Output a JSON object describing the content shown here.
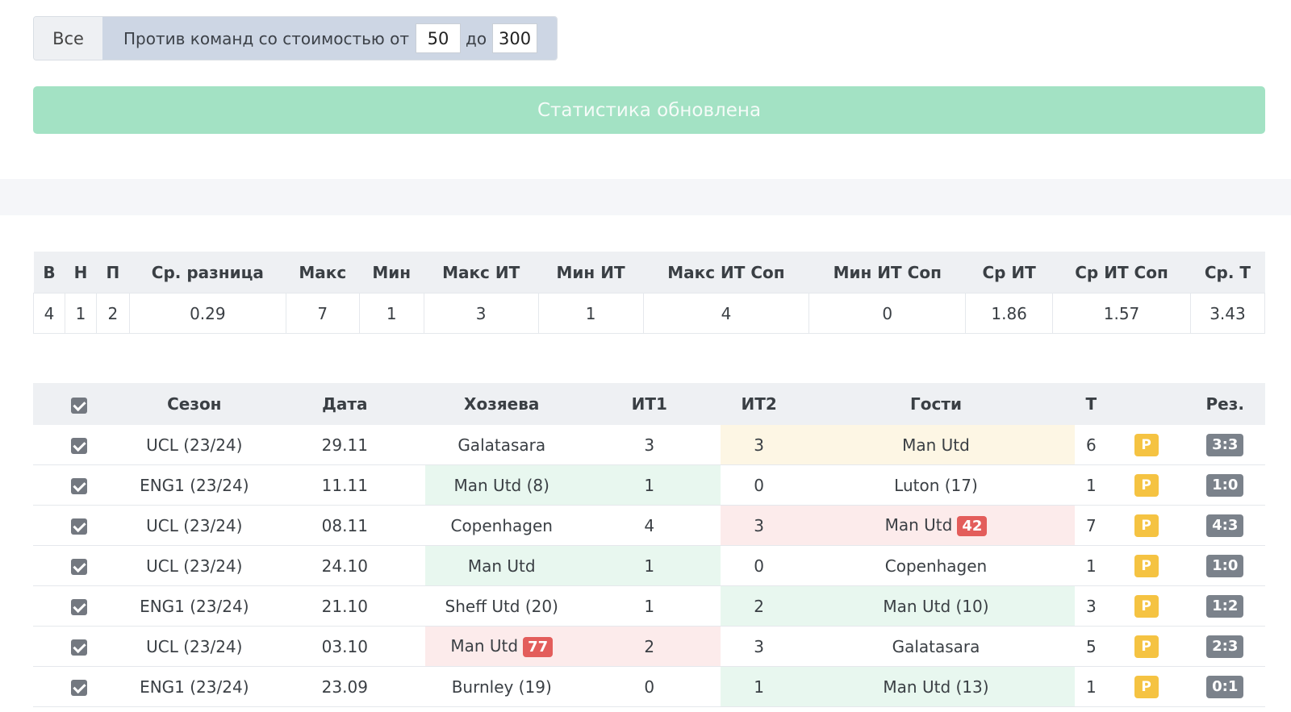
{
  "filter": {
    "all_label": "Все",
    "range_label": "Против команд со стоимостью от",
    "from_value": "50",
    "to_label": "до",
    "to_value": "300"
  },
  "alert": {
    "text": "Статистика обновлена"
  },
  "summary": {
    "headers": [
      "В",
      "Н",
      "П",
      "Ср. разница",
      "Макс",
      "Мин",
      "Макс ИТ",
      "Мин ИТ",
      "Макс ИТ Соп",
      "Мин ИТ Соп",
      "Ср ИТ",
      "Ср ИТ Соп",
      "Ср. Т"
    ],
    "values": [
      "4",
      "1",
      "2",
      "0.29",
      "7",
      "1",
      "3",
      "1",
      "4",
      "0",
      "1.86",
      "1.57",
      "3.43"
    ]
  },
  "matches": {
    "headers": {
      "season": "Сезон",
      "date": "Дата",
      "home": "Хозяева",
      "it1": "ИТ1",
      "it2": "ИТ2",
      "away": "Гости",
      "total": "Т",
      "result": "Рез."
    },
    "rows": [
      {
        "season": "UCL (23/24)",
        "date": "29.11",
        "home": "Galatasara",
        "home_badge": "",
        "it1": "3",
        "it2": "3",
        "away": "Man Utd",
        "away_badge": "",
        "total": "6",
        "p": "P",
        "score": "3:3",
        "hl_home": "",
        "hl_away": "yellow"
      },
      {
        "season": "ENG1 (23/24)",
        "date": "11.11",
        "home": "Man Utd (8)",
        "home_badge": "",
        "it1": "1",
        "it2": "0",
        "away": "Luton (17)",
        "away_badge": "",
        "total": "1",
        "p": "P",
        "score": "1:0",
        "hl_home": "green",
        "hl_away": ""
      },
      {
        "season": "UCL (23/24)",
        "date": "08.11",
        "home": "Copenhagen",
        "home_badge": "",
        "it1": "4",
        "it2": "3",
        "away": "Man Utd",
        "away_badge": "42",
        "total": "7",
        "p": "P",
        "score": "4:3",
        "hl_home": "",
        "hl_away": "red"
      },
      {
        "season": "UCL (23/24)",
        "date": "24.10",
        "home": "Man Utd",
        "home_badge": "",
        "it1": "1",
        "it2": "0",
        "away": "Copenhagen",
        "away_badge": "",
        "total": "1",
        "p": "P",
        "score": "1:0",
        "hl_home": "green",
        "hl_away": ""
      },
      {
        "season": "ENG1 (23/24)",
        "date": "21.10",
        "home": "Sheff Utd (20)",
        "home_badge": "",
        "it1": "1",
        "it2": "2",
        "away": "Man Utd (10)",
        "away_badge": "",
        "total": "3",
        "p": "P",
        "score": "1:2",
        "hl_home": "",
        "hl_away": "green"
      },
      {
        "season": "UCL (23/24)",
        "date": "03.10",
        "home": "Man Utd",
        "home_badge": "77",
        "it1": "2",
        "it2": "3",
        "away": "Galatasara",
        "away_badge": "",
        "total": "5",
        "p": "P",
        "score": "2:3",
        "hl_home": "red",
        "hl_away": ""
      },
      {
        "season": "ENG1 (23/24)",
        "date": "23.09",
        "home": "Burnley (19)",
        "home_badge": "",
        "it1": "0",
        "it2": "1",
        "away": "Man Utd (13)",
        "away_badge": "",
        "total": "1",
        "p": "P",
        "score": "0:1",
        "hl_home": "",
        "hl_away": "green"
      }
    ]
  }
}
